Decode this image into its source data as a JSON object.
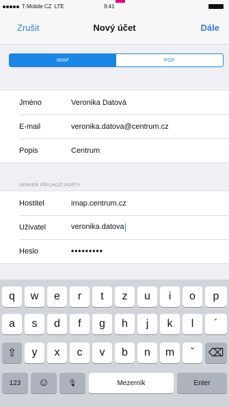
{
  "status_bar": {
    "carrier": "T-Mobile CZ",
    "network": "LTE",
    "time": "9:41"
  },
  "nav": {
    "cancel_label": "Zrušit",
    "title": "Nový účet",
    "next_label": "Dále"
  },
  "segmented": {
    "options": [
      "IMAP",
      "POP"
    ],
    "selected": "IMAP"
  },
  "account": {
    "name_label": "Jméno",
    "name_value": "Veronika Datová",
    "email_label": "E-mail",
    "email_value": "veronika.datova@centrum.cz",
    "description_label": "Popis",
    "description_value": "Centrum"
  },
  "incoming": {
    "header": "SERVER PŘÍCHOZÍ POŠTY",
    "host_label": "Hostitel",
    "host_value": "imap.centrum.cz",
    "user_label": "Uživatel",
    "user_value": "veronika.datova",
    "password_label": "Heslo",
    "password_value": "•••••••••"
  },
  "keyboard": {
    "row1": [
      "q",
      "w",
      "e",
      "r",
      "t",
      "z",
      "u",
      "i",
      "o",
      "p"
    ],
    "row2": [
      "a",
      "s",
      "d",
      "f",
      "g",
      "h",
      "j",
      "k",
      "l",
      "´"
    ],
    "row3": [
      "y",
      "x",
      "c",
      "v",
      "b",
      "n",
      "m",
      "ˇ"
    ],
    "numbers_label": "123",
    "emoji_glyph": "☺",
    "mic_glyph": "🎙",
    "shift_glyph": "⇧",
    "backspace_glyph": "⌫",
    "space_label": "Mezerník",
    "enter_label": "Enter"
  },
  "colors": {
    "accent": "#2f7ddf",
    "segment": "#1a86e6",
    "brand_notch": "#e6007e"
  }
}
